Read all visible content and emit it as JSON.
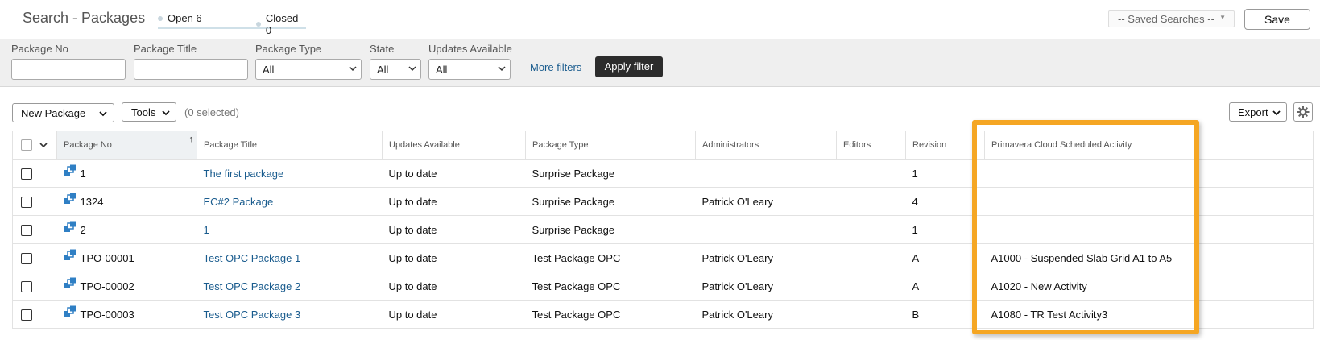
{
  "header": {
    "title": "Search - Packages",
    "status_tabs": [
      {
        "label": "Open 6"
      },
      {
        "label": "Closed 0"
      }
    ],
    "saved_searches": "-- Saved Searches --",
    "save_label": "Save"
  },
  "filters": {
    "package_no": {
      "label": "Package No",
      "value": ""
    },
    "package_title": {
      "label": "Package Title",
      "value": ""
    },
    "package_type": {
      "label": "Package Type",
      "value": "All"
    },
    "state": {
      "label": "State",
      "value": "All"
    },
    "updates_available": {
      "label": "Updates Available",
      "value": "All"
    },
    "more_filters": "More filters",
    "apply_filter": "Apply filter"
  },
  "toolbar": {
    "new_package": "New Package",
    "tools": "Tools",
    "selected": "(0 selected)",
    "export": "Export"
  },
  "table": {
    "columns": {
      "package_no": "Package No",
      "package_title": "Package Title",
      "updates_available": "Updates Available",
      "package_type": "Package Type",
      "administrators": "Administrators",
      "editors": "Editors",
      "revision": "Revision",
      "primavera": "Primavera Cloud Scheduled Activity"
    },
    "sort_indicator": "↑",
    "rows": [
      {
        "no": "1",
        "title": "The first package",
        "updates": "Up to date",
        "type": "Surprise Package",
        "admins": "",
        "editors": "",
        "revision": "1",
        "activity": ""
      },
      {
        "no": "1324",
        "title": "EC#2 Package",
        "updates": "Up to date",
        "type": "Surprise Package",
        "admins": "Patrick O'Leary",
        "editors": "",
        "revision": "4",
        "activity": ""
      },
      {
        "no": "2",
        "title": "1",
        "updates": "Up to date",
        "type": "Surprise Package",
        "admins": "",
        "editors": "",
        "revision": "1",
        "activity": ""
      },
      {
        "no": "TPO-00001",
        "title": "Test OPC Package 1",
        "updates": "Up to date",
        "type": "Test Package OPC",
        "admins": "Patrick O'Leary",
        "editors": "",
        "revision": "A",
        "activity": "A1000 - Suspended Slab Grid A1 to A5"
      },
      {
        "no": "TPO-00002",
        "title": "Test OPC Package 2",
        "updates": "Up to date",
        "type": "Test Package OPC",
        "admins": "Patrick O'Leary",
        "editors": "",
        "revision": "A",
        "activity": "A1020 - New Activity"
      },
      {
        "no": "TPO-00003",
        "title": "Test OPC Package 3",
        "updates": "Up to date",
        "type": "Test Package OPC",
        "admins": "Patrick O'Leary",
        "editors": "",
        "revision": "B",
        "activity": "A1080 - TR Test Activity3"
      }
    ]
  },
  "colors": {
    "link": "#1a5c8e",
    "highlight": "#f5a623",
    "apply_button": "#2c2c2c",
    "package_icon": "#2f7fc4"
  }
}
